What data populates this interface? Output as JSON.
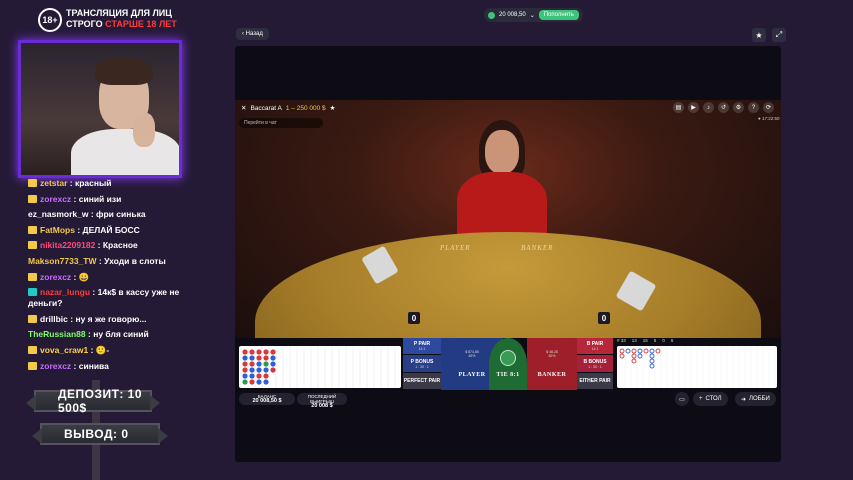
{
  "overlay": {
    "age_badge": "18+",
    "age_line1": "ТРАНСЛЯЦИЯ ДЛЯ ЛИЦ",
    "age_line2_a": "СТРОГО",
    "age_line2_b": "СТАРШЕ 18 ЛЕТ",
    "deposit_label": "ДЕПОЗИТ: 10 500$",
    "withdraw_label": "ВЫВОД: 0"
  },
  "chat": [
    {
      "user": "zetstar",
      "text": "красный",
      "color": "#f2c94c",
      "badge": "yellow"
    },
    {
      "user": "zorexcz",
      "text": "синий изи",
      "color": "#c86cff",
      "badge": "yellow"
    },
    {
      "user": "ez_nasmork_w",
      "text": "фри синька",
      "color": "#ffffff",
      "badge": ""
    },
    {
      "user": "FatMops",
      "text": "ДЕЛАЙ БОСС",
      "color": "#f2c94c",
      "badge": "yellow"
    },
    {
      "user": "nikita2209182",
      "text": "Красное",
      "color": "#ff4b7d",
      "badge": "yellow"
    },
    {
      "user": "Makson7733_TW",
      "text": "Уходи в слоты",
      "color": "#f2c94c",
      "badge": ""
    },
    {
      "user": "zorexcz",
      "text": "😀",
      "color": "#c86cff",
      "badge": "yellow"
    },
    {
      "user": "nazar_lungu",
      "text": "14к$ в кассу уже не деньги?",
      "color": "#ff3b3b",
      "badge": "teal"
    },
    {
      "user": "drillbic",
      "text": "ну я же говорю...",
      "color": "#ffffff",
      "badge": "yellow"
    },
    {
      "user": "TheRussian88",
      "text": "ну бля синий",
      "color": "#7cff6b",
      "badge": ""
    },
    {
      "user": "vova_craw1",
      "text": "🙂-",
      "color": "#ffd24b",
      "badge": "yellow"
    },
    {
      "user": "zorexcz",
      "text": "синива",
      "color": "#c86cff",
      "badge": "yellow"
    }
  ],
  "site": {
    "balance": "20 008,50",
    "deposit_button": "Пополнить",
    "back_button": "Назад",
    "star_icon": "star-icon",
    "fullscreen_icon": "expand-icon"
  },
  "game": {
    "title": "Baccarat A",
    "range": "1 – 250 000 $",
    "search_placeholder": "Перейти в чат",
    "timer": "● 17:22:50",
    "table_player": "PLAYER",
    "table_banker": "BANKER",
    "player_score": "0",
    "banker_score": "0",
    "zones": {
      "p_pair": "P PAIR",
      "p_pair_odds": "11:1",
      "p_bonus": "P BONUS",
      "p_bonus_odds": "1 : 30 : 1",
      "perfect_pair": "PERFECT PAIR",
      "player": "PLAYER",
      "player_pct": "45%",
      "player_amount": "$ 874,85",
      "tie": "TIE",
      "tie_odds": "8:1",
      "banker": "BANKER",
      "banker_pct": "52%",
      "banker_amount": "$ 48,28",
      "b_pair": "B PAIR",
      "b_pair_odds": "11:1",
      "b_bonus": "B BONUS",
      "b_bonus_odds": "1 : 30 : 1",
      "either_pair": "EITHER PAIR"
    },
    "stats": [
      "# 33",
      "13",
      "15",
      "5",
      "0",
      "6"
    ],
    "balance_label": "БАЛАНС",
    "balance_value": "20 008,50 $",
    "last_win_label": "ПОСЛЕДНИЙ ВЫИГРЫШ",
    "last_win_value": "20 008 $",
    "table_button": "СТОЛ",
    "lobby_button": "ЛОББИ"
  },
  "colors": {
    "accent_purple": "#6c2bd9",
    "deposit_green": "#3cc47c",
    "player_blue": "#233b82",
    "banker_red": "#9e1f2a",
    "tie_green": "#1f6b34"
  }
}
